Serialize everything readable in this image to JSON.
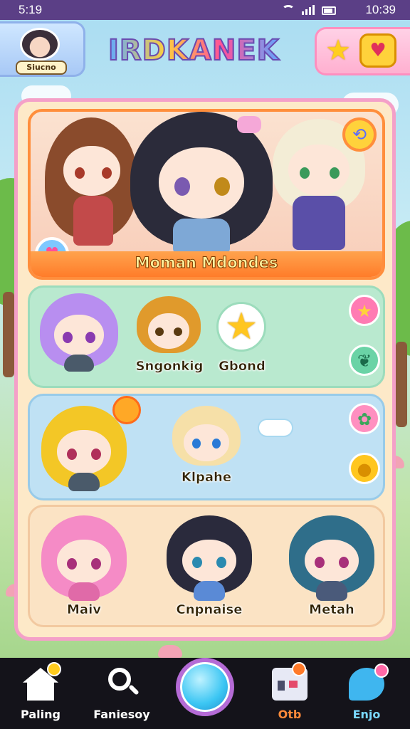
{
  "status_bar": {
    "time": "5:19",
    "clock": "10:39"
  },
  "header": {
    "app_title": "IRDKANEK",
    "profile_name": "Siucno"
  },
  "featured": {
    "title": "Moman Mdondes"
  },
  "rows": [
    {
      "characters": [
        {
          "name": "Sngonkig",
          "hair": "#b88ef0"
        },
        {
          "name": "Gbond",
          "hair": "#e09a2c"
        }
      ]
    },
    {
      "characters": [
        {
          "name": "",
          "hair": "#f3c726"
        },
        {
          "name": "Klpahe",
          "hair": "#f6e0a8"
        }
      ]
    },
    {
      "characters": [
        {
          "name": "Maiv",
          "hair": "#f58bc6"
        },
        {
          "name": "Cnpnaise",
          "hair": "#2a2a3c"
        },
        {
          "name": "Metah",
          "hair": "#2f6e8a"
        }
      ]
    }
  ],
  "nav": [
    {
      "label": "Paling",
      "icon": "home-icon"
    },
    {
      "label": "Faniesoy",
      "icon": "search-icon"
    },
    {
      "label": "",
      "icon": "center-action-icon"
    },
    {
      "label": "Otb",
      "icon": "shop-icon"
    },
    {
      "label": "Enjo",
      "icon": "chat-icon"
    }
  ],
  "colors": {
    "accent": "#f4a0c8",
    "featured_border": "#ff8e3c",
    "nav_bg": "#14131a"
  }
}
